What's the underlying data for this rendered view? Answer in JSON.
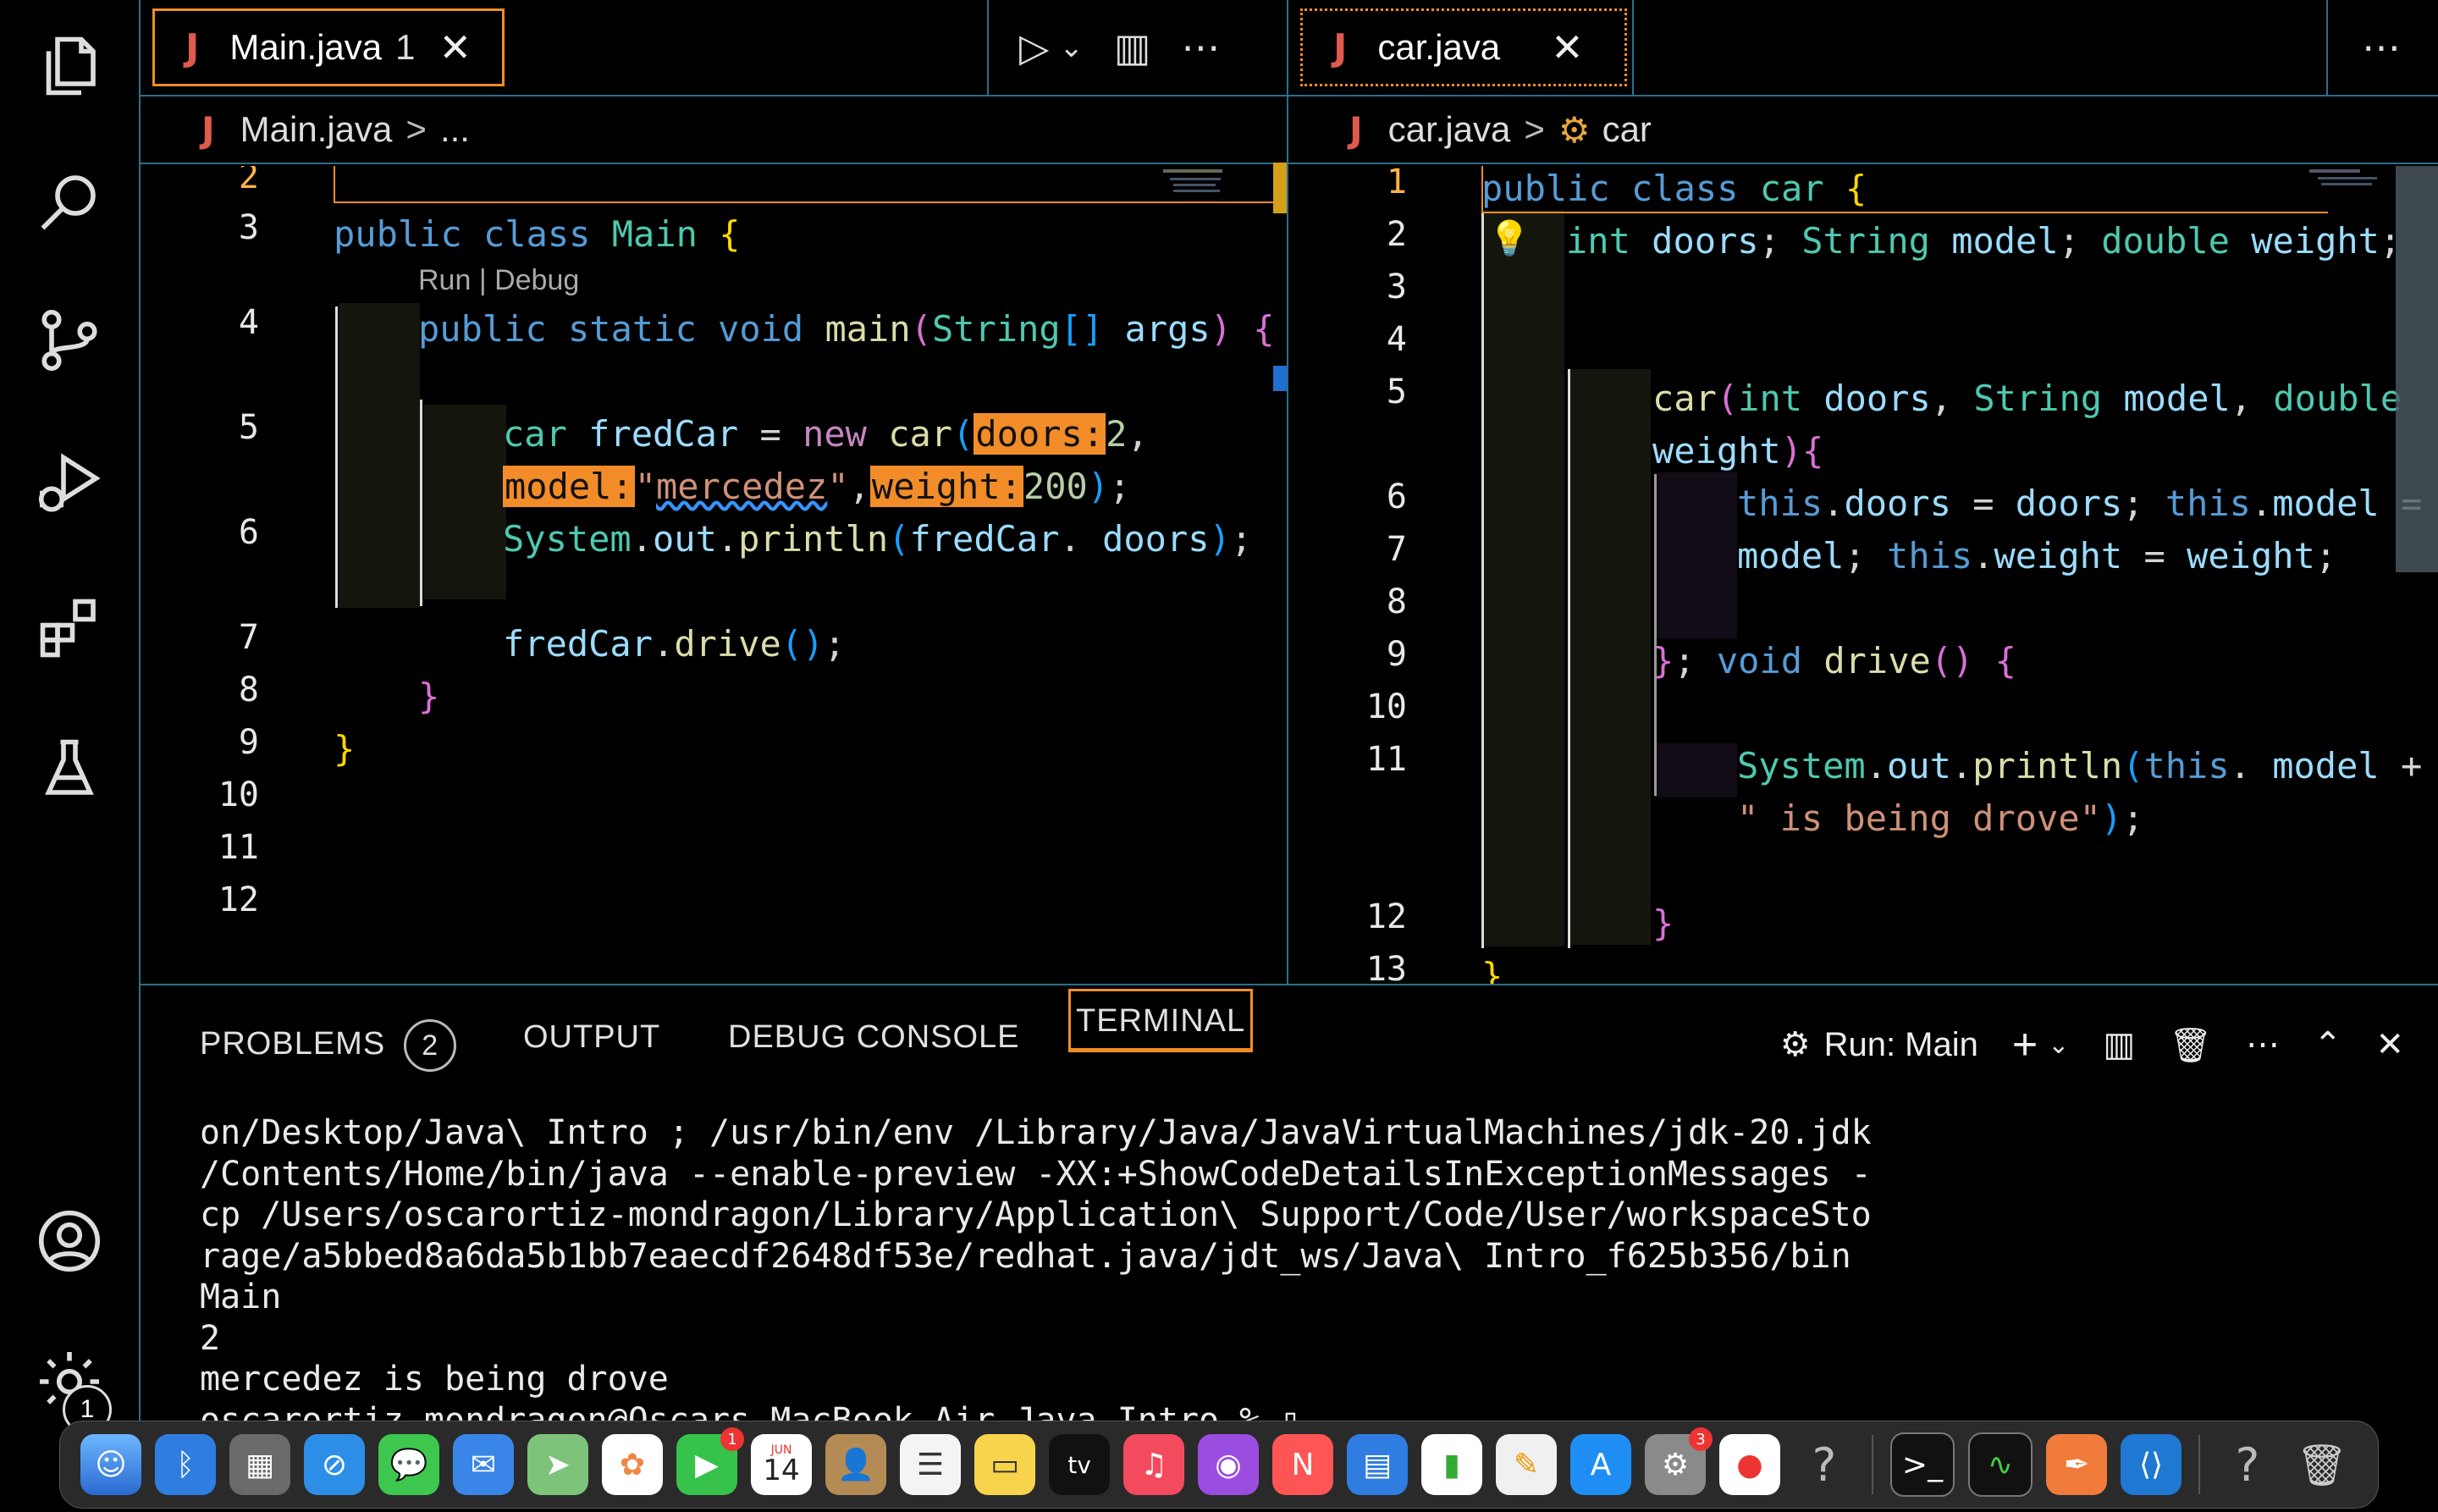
{
  "left_editor": {
    "tab": {
      "icon": "J",
      "label": "Main.java",
      "problems": "1",
      "close": "✕"
    },
    "actions": {
      "run": "▷",
      "run_dropdown": "⌄",
      "split": "▥",
      "more": "⋯"
    },
    "breadcrumb": {
      "icon": "J",
      "file": "Main.java",
      "sep": ">",
      "rest": "..."
    },
    "codelens": "Run | Debug",
    "line_numbers": [
      "2",
      "3",
      "4",
      "",
      "5",
      "",
      "6",
      "",
      "7",
      "8",
      "9",
      "10",
      "11",
      "12"
    ]
  },
  "right_editor": {
    "tab": {
      "icon": "J",
      "label": "car.java",
      "close": "✕"
    },
    "actions": {
      "more": "⋯"
    },
    "breadcrumb": {
      "icon": "J",
      "file": "car.java",
      "sep": ">",
      "symbol": "car"
    },
    "line_numbers": [
      "1",
      "2",
      "3",
      "4",
      "5",
      "",
      "6",
      "7",
      "8",
      "9",
      "10",
      "11",
      "",
      "",
      "12",
      "13"
    ]
  },
  "panel": {
    "tabs": {
      "problems": "PROBLEMS",
      "problems_count": "2",
      "output": "OUTPUT",
      "debug_console": "DEBUG CONSOLE",
      "terminal": "TERMINAL"
    },
    "run_label": "Run: Main",
    "terminal_lines": [
      "on/Desktop/Java\\ Intro ; /usr/bin/env /Library/Java/JavaVirtualMachines/jdk-20.jdk",
      "/Contents/Home/bin/java --enable-preview -XX:+ShowCodeDetailsInExceptionMessages -",
      "cp /Users/oscarortiz-mondragon/Library/Application\\ Support/Code/User/workspaceSto",
      "rage/a5bbed8a6da5b1bb7eaecdf2648df53e/redhat.java/jdt_ws/Java\\ Intro_f625b356/bin",
      "Main",
      "2",
      "mercedez is being drove",
      "oscarortiz-mondragon@Oscars-MacBook-Air Java Intro % ▯"
    ]
  },
  "activity": {
    "settings_badge": "1"
  },
  "dock": {
    "calendar_month": "JUN",
    "calendar_day": "14",
    "facetime_badge": "1",
    "settings_badge": "3",
    "tv_label": "tv"
  },
  "colors": {
    "accent": "#f28c28",
    "border": "#2a6f8a",
    "keyword": "#569cd6",
    "type": "#4ec9b0",
    "function": "#dcdcaa",
    "string": "#ce9178"
  }
}
